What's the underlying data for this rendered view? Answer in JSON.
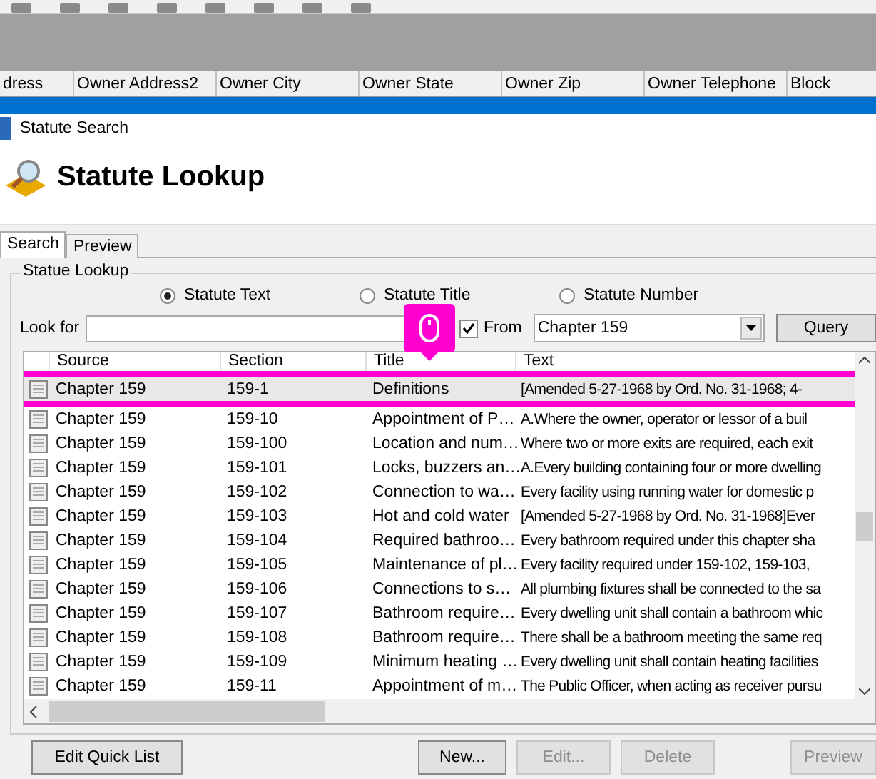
{
  "background_grid": {
    "columns": [
      "dress",
      "Owner Address2",
      "Owner City",
      "Owner State",
      "Owner Zip",
      "Owner Telephone",
      "Block"
    ]
  },
  "dialog": {
    "title": "Statute Search",
    "header": "Statute Lookup",
    "tabs": [
      {
        "label": "Search",
        "selected": true
      },
      {
        "label": "Preview",
        "selected": false
      }
    ],
    "group_title": "Statue Lookup",
    "search_modes": [
      {
        "label": "Statute Text",
        "selected": true
      },
      {
        "label": "Statute Title",
        "selected": false
      },
      {
        "label": "Statute Number",
        "selected": false
      }
    ],
    "look_for_label": "Look for",
    "from": {
      "label": "From",
      "checked": true,
      "value": "Chapter 159"
    },
    "query_button": "Query",
    "table": {
      "columns": [
        "Source",
        "Section",
        "Title",
        "Text"
      ],
      "rows": [
        {
          "source": "Chapter 159",
          "section": "159-1",
          "title": "Definitions",
          "text": "[Amended 5-27-1968 by Ord. No. 31-1968; 4-",
          "selected": true
        },
        {
          "source": "Chapter 159",
          "section": "159-10",
          "title": "Appointment of P…",
          "text": "A.Where the owner, operator or lessor of a buil",
          "selected": false
        },
        {
          "source": "Chapter 159",
          "section": "159-100",
          "title": "Location and num…",
          "text": "Where two or more exits are required, each exit",
          "selected": false
        },
        {
          "source": "Chapter 159",
          "section": "159-101",
          "title": "Locks, buzzers an…",
          "text": "A.Every building containing four or more dwelling",
          "selected": false
        },
        {
          "source": "Chapter 159",
          "section": "159-102",
          "title": "Connection to wa…",
          "text": "Every facility using running water for domestic p",
          "selected": false
        },
        {
          "source": "Chapter 159",
          "section": "159-103",
          "title": "Hot and cold water",
          "text": "[Amended 5-27-1968 by Ord. No. 31-1968]Ever",
          "selected": false
        },
        {
          "source": "Chapter 159",
          "section": "159-104",
          "title": "Required bathroo…",
          "text": "Every bathroom required under this chapter sha",
          "selected": false
        },
        {
          "source": "Chapter 159",
          "section": "159-105",
          "title": "Maintenance of pl…",
          "text": "Every facility required under  159-102, 159-103,",
          "selected": false
        },
        {
          "source": "Chapter 159",
          "section": "159-106",
          "title": "Connections to s…",
          "text": "All plumbing fixtures shall be connected to the sa",
          "selected": false
        },
        {
          "source": "Chapter 159",
          "section": "159-107",
          "title": "Bathroom require…",
          "text": "Every dwelling unit shall contain a bathroom whic",
          "selected": false
        },
        {
          "source": "Chapter 159",
          "section": "159-108",
          "title": "Bathroom require…",
          "text": "There shall be a bathroom meeting the same req",
          "selected": false
        },
        {
          "source": "Chapter 159",
          "section": "159-109",
          "title": "Minimum heating …",
          "text": "Every dwelling unit shall contain heating facilities",
          "selected": false
        },
        {
          "source": "Chapter 159",
          "section": "159-11",
          "title": "Appointment of m…",
          "text": "The Public Officer, when acting as receiver pursu",
          "selected": false
        }
      ]
    },
    "buttons": [
      {
        "label": "Edit Quick List",
        "disabled": false
      },
      {
        "label": "New...",
        "disabled": false
      },
      {
        "label": "Edit...",
        "disabled": true
      },
      {
        "label": "Delete",
        "disabled": true
      },
      {
        "label": "Preview",
        "disabled": true
      }
    ]
  }
}
